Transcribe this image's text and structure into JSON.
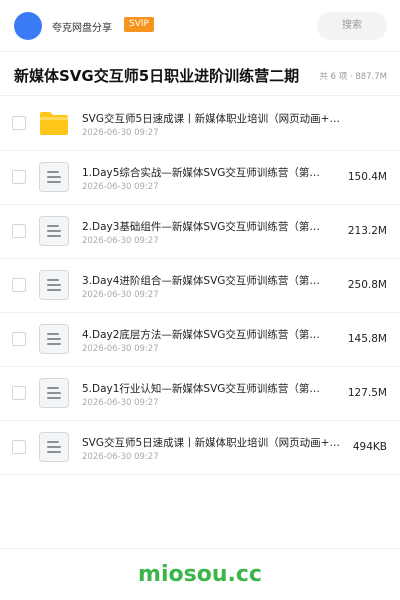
{
  "header": {
    "owner_name": "夸克网盘分享",
    "badge": "SVIP",
    "search_placeholder": "搜索"
  },
  "title_bar": {
    "title": "新媒体SVG交互师5日职业进阶训练营二期",
    "summary": "共 6 项 · 887.7M"
  },
  "files": [
    {
      "type": "folder",
      "name": "SVG交互师5日速成课丨新媒体职业培训（网页动画+…",
      "date": "2026-06-30 09:27",
      "size": ""
    },
    {
      "type": "file",
      "name": "1.Day5综合实战—新媒体SVG交互师训练营（第…",
      "date": "2026-06-30 09:27",
      "size": "150.4M"
    },
    {
      "type": "file",
      "name": "2.Day3基础组件—新媒体SVG交互师训练营（第…",
      "date": "2026-06-30 09:27",
      "size": "213.2M"
    },
    {
      "type": "file",
      "name": "3.Day4进阶组合—新媒体SVG交互师训练营（第…",
      "date": "2026-06-30 09:27",
      "size": "250.8M"
    },
    {
      "type": "file",
      "name": "4.Day2底层方法—新媒体SVG交互师训练营（第…",
      "date": "2026-06-30 09:27",
      "size": "145.8M"
    },
    {
      "type": "file",
      "name": "5.Day1行业认知—新媒体SVG交互师训练营（第…",
      "date": "2026-06-30 09:27",
      "size": "127.5M"
    },
    {
      "type": "file",
      "name": "SVG交互师5日速成课丨新媒体职业培训（网页动画+…",
      "date": "2026-06-30 09:27",
      "size": "494KB"
    }
  ],
  "footer": {
    "watermark": "miosou.cc"
  },
  "colors": {
    "accent": "#3b7cf6",
    "badge": "#f7941d",
    "folder": "#ffc61a",
    "watermark": "#3cb54a"
  },
  "icons": {
    "folder": "folder-icon",
    "file": "document-icon"
  }
}
